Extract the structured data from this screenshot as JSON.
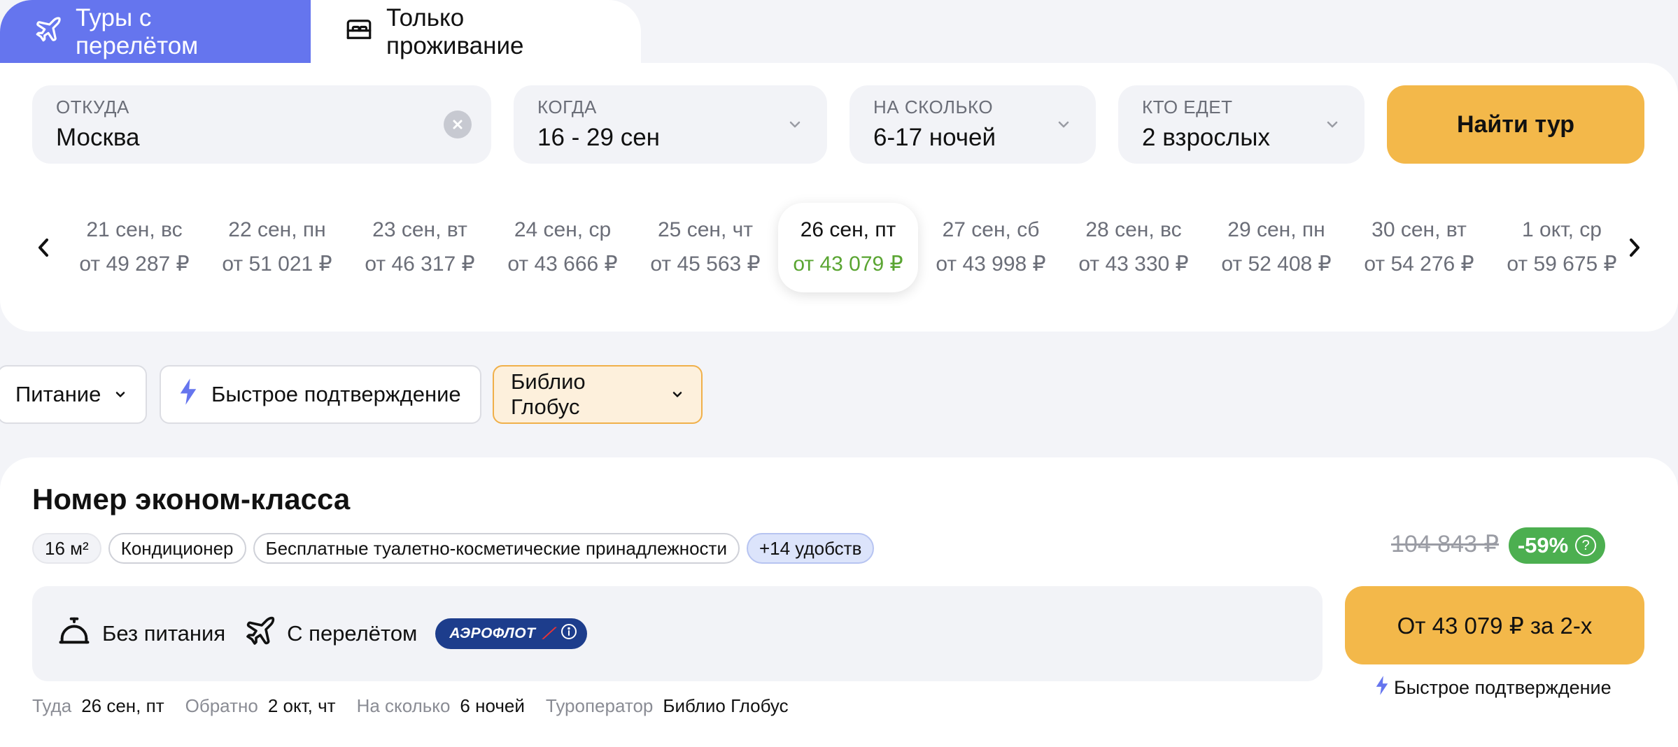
{
  "tabs": {
    "tours_label": "Туры с перелётом",
    "hotels_label": "Только проживание"
  },
  "search": {
    "from_label": "ОТКУДА",
    "from_value": "Москва",
    "when_label": "КОГДА",
    "when_value": "16 - 29 сен",
    "nights_label": "НА СКОЛЬКО",
    "nights_value": "6-17 ночей",
    "who_label": "КТО ЕДЕТ",
    "who_value": "2 взрослых",
    "submit_label": "Найти тур"
  },
  "dates": [
    {
      "date": "21 сен, вс",
      "price": "от 49 287 ₽"
    },
    {
      "date": "22 сен, пн",
      "price": "от 51 021 ₽"
    },
    {
      "date": "23 сен, вт",
      "price": "от 46 317 ₽"
    },
    {
      "date": "24 сен, ср",
      "price": "от 43 666 ₽"
    },
    {
      "date": "25 сен, чт",
      "price": "от 45 563 ₽"
    },
    {
      "date": "26 сен, пт",
      "price": "от 43 079 ₽"
    },
    {
      "date": "27 сен, сб",
      "price": "от 43 998 ₽"
    },
    {
      "date": "28 сен, вс",
      "price": "от 43 330 ₽"
    },
    {
      "date": "29 сен, пн",
      "price": "от 52 408 ₽"
    },
    {
      "date": "30 сен, вт",
      "price": "от 54 276 ₽"
    },
    {
      "date": "1 окт, ср",
      "price": "от 59 675 ₽"
    }
  ],
  "selected_date_index": 5,
  "filters": {
    "meal_label": "Питание",
    "fast_confirm_label": "Быстрое подтверждение",
    "operator_label": "Библио Глобус"
  },
  "result": {
    "title": "Номер эконом-класса",
    "tags": [
      "16 м²",
      "Кондиционер",
      "Бесплатные туалетно-косметические принадлежности",
      "+14 удобств"
    ],
    "meal": "Без питания",
    "flight": "С перелётом",
    "airline": "АЭРОФЛОТ",
    "old_price": "104 843 ₽",
    "discount": "-59%",
    "buy_label": "От 43 079 ₽ за 2-х",
    "fast_confirm": "Быстрое подтверждение",
    "info": {
      "there_key": "Туда",
      "there_val": "26 сен, пт",
      "back_key": "Обратно",
      "back_val": "2 окт, чт",
      "dur_key": "На сколько",
      "dur_val": "6 ночей",
      "op_key": "Туроператор",
      "op_val": "Библио Глобус"
    }
  },
  "colors": {
    "accent": "#6575ee",
    "button": "#f3b84a",
    "price_active": "#5aa532",
    "discount": "#4caf50"
  }
}
